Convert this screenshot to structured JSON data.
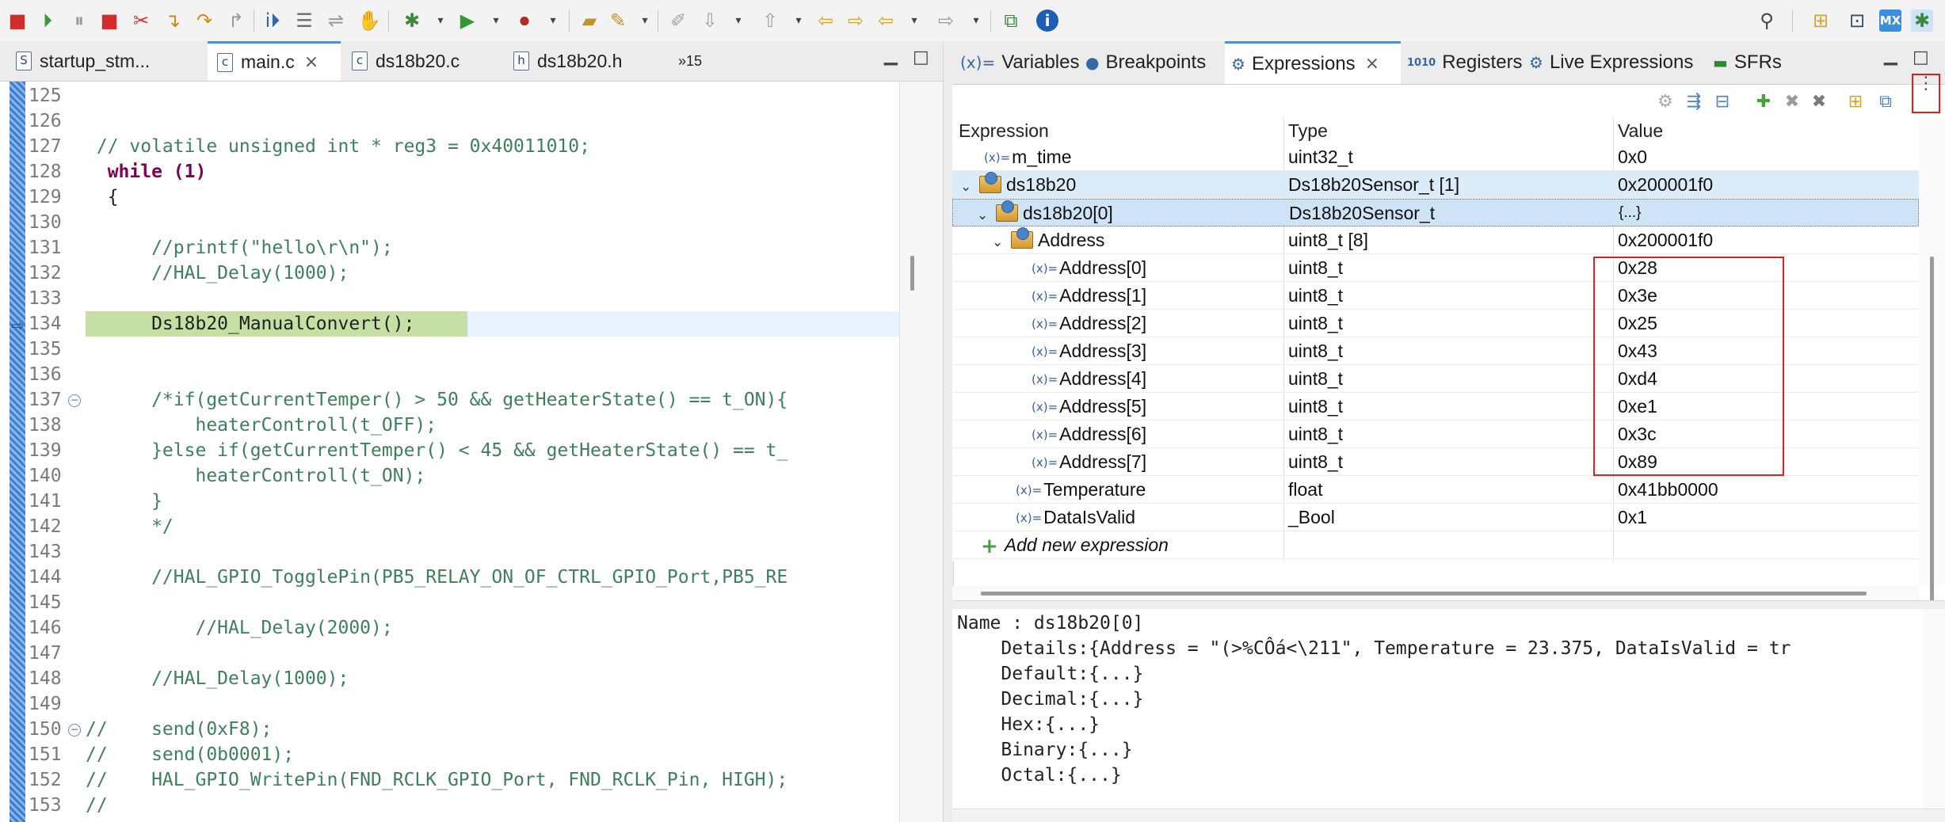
{
  "editor": {
    "tabs": [
      {
        "icon": "S",
        "label": "startup_stm...",
        "active": false
      },
      {
        "icon": "c",
        "label": "main.c",
        "active": true
      },
      {
        "icon": "c",
        "label": "ds18b20.c",
        "active": false
      },
      {
        "icon": "h",
        "label": "ds18b20.h",
        "active": false
      }
    ],
    "overflow_label": "»15",
    "lines": [
      {
        "n": "125",
        "code": ""
      },
      {
        "n": "126",
        "code": ""
      },
      {
        "n": "127",
        "code": " // volatile unsigned int * reg3 = 0x40011010;"
      },
      {
        "n": "128",
        "code": "  while (1)"
      },
      {
        "n": "129",
        "code": "  {"
      },
      {
        "n": "130",
        "code": ""
      },
      {
        "n": "131",
        "code": "      //printf(\"hello\\r\\n\");"
      },
      {
        "n": "132",
        "code": "      //HAL_Delay(1000);"
      },
      {
        "n": "133",
        "code": ""
      },
      {
        "n": "134",
        "code": "      Ds18b20_ManualConvert();"
      },
      {
        "n": "135",
        "code": ""
      },
      {
        "n": "136",
        "code": ""
      },
      {
        "n": "137",
        "code": "      /*if(getCurrentTemper() > 50 && getHeaterState() == t_ON){"
      },
      {
        "n": "138",
        "code": "          heaterControll(t_OFF);"
      },
      {
        "n": "139",
        "code": "      }else if(getCurrentTemper() < 45 && getHeaterState() == t_"
      },
      {
        "n": "140",
        "code": "          heaterControll(t_ON);"
      },
      {
        "n": "141",
        "code": "      }"
      },
      {
        "n": "142",
        "code": "      */"
      },
      {
        "n": "143",
        "code": ""
      },
      {
        "n": "144",
        "code": "      //HAL_GPIO_TogglePin(PB5_RELAY_ON_OF_CTRL_GPIO_Port,PB5_RE"
      },
      {
        "n": "145",
        "code": ""
      },
      {
        "n": "146",
        "code": "          //HAL_Delay(2000);"
      },
      {
        "n": "147",
        "code": ""
      },
      {
        "n": "148",
        "code": "      //HAL_Delay(1000);"
      },
      {
        "n": "149",
        "code": ""
      },
      {
        "n": "150",
        "code": "//    send(0xF8);"
      },
      {
        "n": "151",
        "code": "//    send(0b0001);"
      },
      {
        "n": "152",
        "code": "//    HAL_GPIO_WritePin(FND_RCLK_GPIO_Port, FND_RCLK_Pin, HIGH);"
      },
      {
        "n": "153",
        "code": "//"
      }
    ]
  },
  "right_panel": {
    "tabs": [
      {
        "icon": "(x)=",
        "label": "Variables"
      },
      {
        "icon": "●",
        "label": "Breakpoints"
      },
      {
        "icon": "⚙",
        "label": "Expressions",
        "active": true
      },
      {
        "icon": "1010",
        "label": "Registers"
      },
      {
        "icon": "⚙",
        "label": "Live Expressions"
      },
      {
        "icon": "▬",
        "label": "SFRs"
      }
    ],
    "columns": {
      "expression": "Expression",
      "type": "Type",
      "value": "Value"
    },
    "rows": [
      {
        "name": "m_time",
        "type": "uint32_t",
        "value": "0x0",
        "kind": "var",
        "indent": 0
      },
      {
        "name": "ds18b20",
        "type": "Ds18b20Sensor_t [1]",
        "value": "0x200001f0",
        "kind": "struct",
        "indent": 0,
        "expanded": true
      },
      {
        "name": "ds18b20[0]",
        "type": "Ds18b20Sensor_t",
        "value": "{...}",
        "kind": "struct",
        "indent": 1,
        "expanded": true,
        "selected": true
      },
      {
        "name": "Address",
        "type": "uint8_t [8]",
        "value": "0x200001f0",
        "kind": "struct",
        "indent": 2,
        "expanded": true
      },
      {
        "name": "Address[0]",
        "type": "uint8_t",
        "value": "0x28",
        "kind": "var",
        "indent": 3
      },
      {
        "name": "Address[1]",
        "type": "uint8_t",
        "value": "0x3e",
        "kind": "var",
        "indent": 3
      },
      {
        "name": "Address[2]",
        "type": "uint8_t",
        "value": "0x25",
        "kind": "var",
        "indent": 3
      },
      {
        "name": "Address[3]",
        "type": "uint8_t",
        "value": "0x43",
        "kind": "var",
        "indent": 3
      },
      {
        "name": "Address[4]",
        "type": "uint8_t",
        "value": "0xd4",
        "kind": "var",
        "indent": 3
      },
      {
        "name": "Address[5]",
        "type": "uint8_t",
        "value": "0xe1",
        "kind": "var",
        "indent": 3
      },
      {
        "name": "Address[6]",
        "type": "uint8_t",
        "value": "0x3c",
        "kind": "var",
        "indent": 3
      },
      {
        "name": "Address[7]",
        "type": "uint8_t",
        "value": "0x89",
        "kind": "var",
        "indent": 3
      },
      {
        "name": "Temperature",
        "type": "float",
        "value": "0x41bb0000",
        "kind": "var",
        "indent": 2
      },
      {
        "name": "DataIsValid",
        "type": "_Bool",
        "value": "0x1",
        "kind": "var",
        "indent": 2
      }
    ],
    "add_expression": "Add new expression",
    "details": [
      "Name : ds18b20[0]",
      "    Details:{Address = \"(>%CÔá<\\211\", Temperature = 23.375, DataIsValid = tr",
      "    Default:{...}",
      "    Decimal:{...}",
      "    Hex:{...}",
      "    Binary:{...}",
      "    Octal:{...}"
    ]
  },
  "colors": {
    "accent": "#4d8fd6",
    "highlight_box": "#e02020",
    "exec_line": "#c6dfa5",
    "selected_row": "#cfe3f7"
  }
}
